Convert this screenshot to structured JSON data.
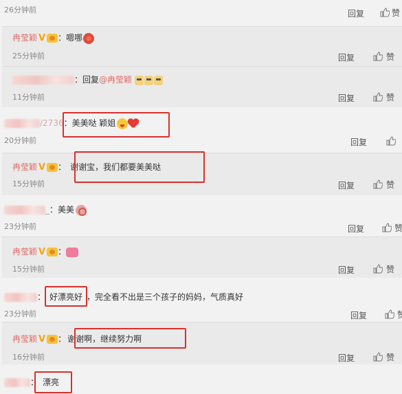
{
  "labels": {
    "reply": "回复",
    "like": "赞"
  },
  "colors": {
    "username": "#e06a64",
    "verified": "#f3a40f",
    "highlight_box": "#d9302a"
  },
  "comments": [
    {
      "time": "26分钟前"
    },
    {
      "user": "冉莹颖",
      "sep": "：",
      "text": "嗯哪",
      "emoji": "flower-emoji",
      "time": "25分钟前"
    },
    {
      "sep": "：",
      "reply_prefix": "回复",
      "mention": "@冉莹颖",
      "emoji": "doge-emoji",
      "time": "11分钟前"
    },
    {
      "user_visible": "/2736",
      "sep": "：",
      "text": "美美哒 颖姐",
      "emoji": "heart-emoji",
      "time": "20分钟前"
    },
    {
      "user": "冉莹颖",
      "sep": "：",
      "text": "谢谢宝，我们都要美美哒",
      "time": "15分钟前"
    },
    {
      "user_visible": "_",
      "sep": "：",
      "text": "美美",
      "emoji": "bluff-emoji",
      "time": "23分钟前"
    },
    {
      "user": "冉莹颖",
      "sep": "：",
      "emoji": "pinkhand-emoji",
      "time": "15分钟前"
    },
    {
      "sep": "：",
      "text_boxed": "好漂亮好",
      "text_rest": "，完全看不出是三个孩子的妈妈，气质真好",
      "time": "23分钟前"
    },
    {
      "user": "冉莹颖",
      "sep": "：",
      "text": "谢谢啊，继续努力啊",
      "time": "16分钟前"
    },
    {
      "sep": "：",
      "text": "漂亮"
    }
  ]
}
